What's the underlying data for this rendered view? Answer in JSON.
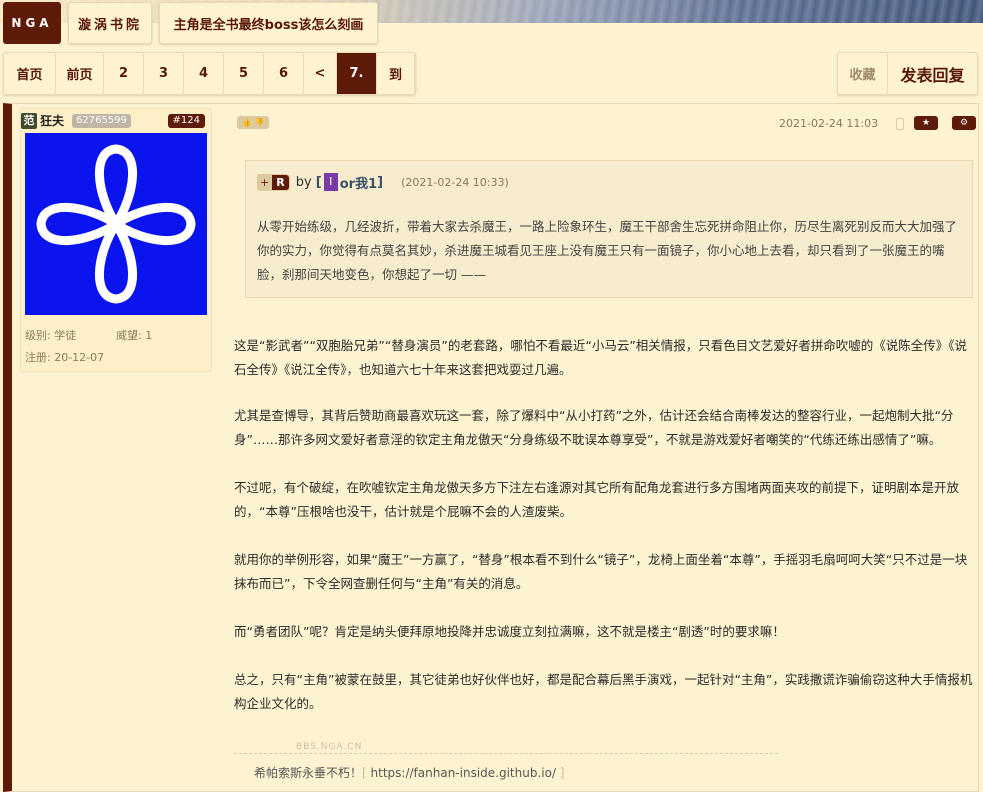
{
  "site": {
    "logo": "NGA"
  },
  "breadcrumb": {
    "forum": "漩涡书院",
    "thread": "主角是全书最终boss该怎么刻画"
  },
  "pager": {
    "items": [
      {
        "label": "首页",
        "w": 52
      },
      {
        "label": "前页",
        "w": 48
      },
      {
        "label": "2",
        "w": 40
      },
      {
        "label": "3",
        "w": 40
      },
      {
        "label": "4",
        "w": 40
      },
      {
        "label": "5",
        "w": 40
      },
      {
        "label": "6",
        "w": 40
      },
      {
        "label": "<",
        "w": 33
      },
      {
        "label": "7.",
        "w": 40,
        "current": true
      },
      {
        "label": "到",
        "w": 38
      }
    ]
  },
  "actions": {
    "favorite": "收藏",
    "reply": "发表回复"
  },
  "post": {
    "user": {
      "icon": "范",
      "name": "狂夫",
      "uid": "62765599",
      "floor": "#124",
      "level": "级别: 学徒",
      "prestige": "威望: 1",
      "registered": "注册: 20-12-07"
    },
    "avatar_color": "#0a14ee",
    "timestamp": "2021-02-24 11:03",
    "quote": {
      "tag_plus": "+",
      "tag_r": "R",
      "by": "by",
      "bracket_open": "[",
      "avatar_letter": "I",
      "author": "or我1",
      "bracket_close": "]",
      "time": "(2021-02-24 10:33)",
      "text": "从零开始练级，几经波折，带着大家去杀魔王，一路上险象环生，魔王干部舍生忘死拼命阻止你，历尽生离死别反而大大加强了你的实力，你觉得有点莫名其妙，杀进魔王城看见王座上没有魔王只有一面镜子，你小心地上去看，却只看到了一张魔王的嘴脸，刹那间天地变色，你想起了一切 ——"
    },
    "paragraphs": [
      "这是“影武者”“双胞胎兄弟”“替身演员”的老套路，哪怕不看最近“小马云”相关情报，只看色目文艺爱好者拼命吹嘘的《说陈全传》《说石全传》《说江全传》，也知道六七十年来这套把戏耍过几遍。",
      "尤其是查博导，其背后赞助商最喜欢玩这一套，除了爆料中“从小打药”之外，估计还会结合南棒发达的整容行业，一起炮制大批“分身”……那许多网文爱好者意淫的钦定主角龙傲天“分身练级不耽误本尊享受”，不就是游戏爱好者嘲笑的“代练还练出感情了”嘛。",
      "不过呢，有个破绽，在吹嘘钦定主角龙傲天多方下注左右逢源对其它所有配角龙套进行多方围堵两面夹攻的前提下，证明剧本是开放的，“本尊”压根啥也没干，估计就是个屁嘛不会的人渣废柴。",
      "就用你的举例形容，如果“魔王”一方赢了，“替身”根本看不到什么“镜子”，龙椅上面坐着“本尊”，手摇羽毛扇呵呵大笑“只不过是一块抹布而已”，下令全网查删任何与“主角”有关的消息。",
      "而“勇者团队”呢？肯定是纳头便拜原地投降并忠诚度立刻拉满嘛，这不就是楼主“剧透”时的要求嘛！",
      "总之，只有“主角”被蒙在鼓里，其它徒弟也好伙伴也好，都是配合幕后黑手演戏，一起针对“主角”，实践撒谎诈骗偷窃这种大手情报机构企业文化的。"
    ],
    "signature": {
      "watermark": "BBS.NGA.CN",
      "text": "希帕索斯永垂不朽！",
      "link": "https://fanhan-inside.github.io/"
    }
  }
}
